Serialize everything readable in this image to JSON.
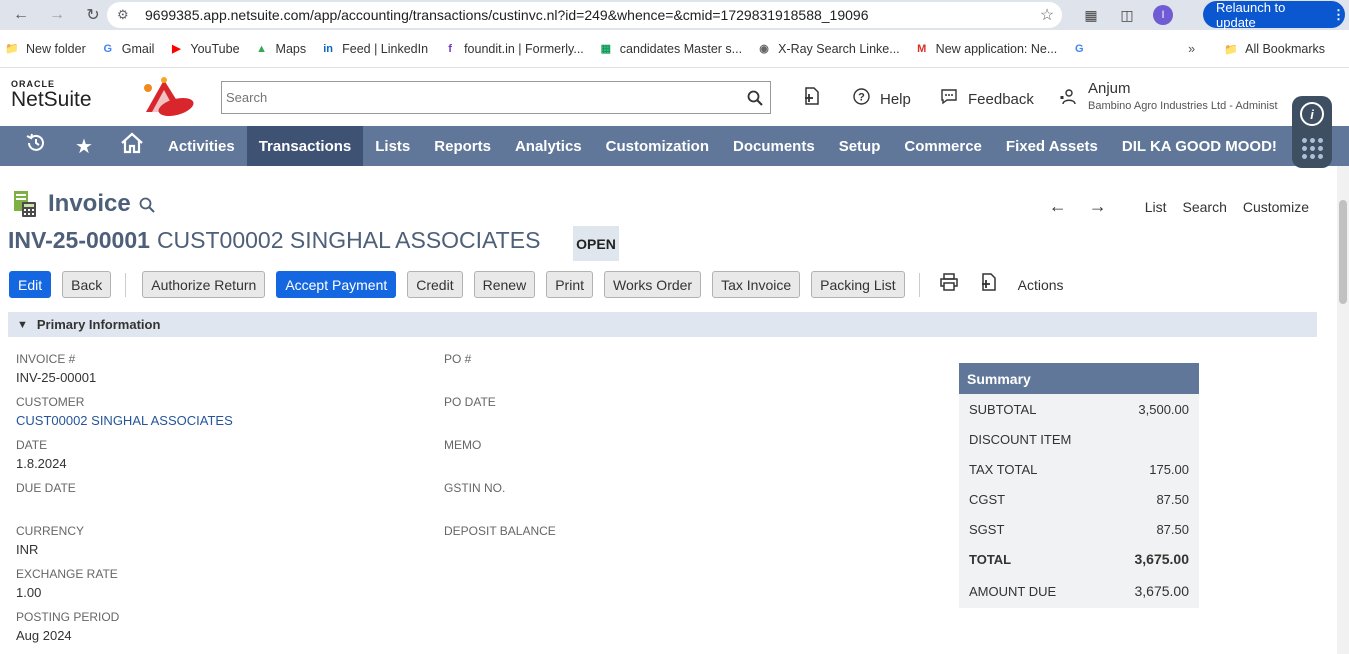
{
  "browser": {
    "url": "9699385.app.netsuite.com/app/accounting/transactions/custinvc.nl?id=249&whence=&cmid=1729831918588_19096",
    "relaunch_label": "Relaunch to update",
    "avatar_letter": "I",
    "bookmarks": [
      {
        "label": "New folder",
        "icon": "folder-icon",
        "color": "#444"
      },
      {
        "label": "Gmail",
        "icon": "google-icon",
        "color": "#4285f4"
      },
      {
        "label": "YouTube",
        "icon": "youtube-icon",
        "color": "#ff0000"
      },
      {
        "label": "Maps",
        "icon": "maps-icon",
        "color": "#34a853"
      },
      {
        "label": "Feed | LinkedIn",
        "icon": "linkedin-icon",
        "color": "#0a66c2"
      },
      {
        "label": "foundit.in | Formerly...",
        "icon": "foundit-icon",
        "color": "#6e3cbc"
      },
      {
        "label": "candidates Master s...",
        "icon": "sheets-icon",
        "color": "#0f9d58"
      },
      {
        "label": "X-Ray Search Linke...",
        "icon": "globe-icon",
        "color": "#666"
      },
      {
        "label": "New application: Ne...",
        "icon": "gmail-icon",
        "color": "#d93025"
      },
      {
        "label": "",
        "icon": "google-icon",
        "color": "#4285f4"
      }
    ],
    "all_bookmarks_label": "All Bookmarks"
  },
  "header": {
    "logo_oracle": "ORACLE",
    "logo_netsuite": "NetSuite",
    "search_placeholder": "Search",
    "help_label": "Help",
    "feedback_label": "Feedback",
    "user_name": "Anjum",
    "user_company": "Bambino Agro Industries Ltd - Administ"
  },
  "nav": {
    "items": [
      "Activities",
      "Transactions",
      "Lists",
      "Reports",
      "Analytics",
      "Customization",
      "Documents",
      "Setup",
      "Commerce",
      "Fixed Assets",
      "DIL KA GOOD MOOD!"
    ],
    "active": "Transactions"
  },
  "page": {
    "title": "Invoice",
    "record_number": "INV-25-00001",
    "record_customer": "CUST00002 SINGHAL ASSOCIATES",
    "status": "OPEN",
    "links": {
      "list": "List",
      "search": "Search",
      "customize": "Customize"
    },
    "buttons": {
      "edit": "Edit",
      "back": "Back",
      "authorize_return": "Authorize Return",
      "accept_payment": "Accept Payment",
      "credit": "Credit",
      "renew": "Renew",
      "print": "Print",
      "works_order": "Works Order",
      "tax_invoice": "Tax Invoice",
      "packing_list": "Packing List",
      "actions": "Actions"
    }
  },
  "primary": {
    "section_title": "Primary Information",
    "left": [
      {
        "label": "INVOICE #",
        "value": "INV-25-00001"
      },
      {
        "label": "CUSTOMER",
        "value": "CUST00002 SINGHAL ASSOCIATES"
      },
      {
        "label": "DATE",
        "value": "1.8.2024"
      },
      {
        "label": "DUE DATE",
        "value": ""
      },
      {
        "label": "CURRENCY",
        "value": "INR"
      },
      {
        "label": "EXCHANGE RATE",
        "value": "1.00"
      },
      {
        "label": "POSTING PERIOD",
        "value": "Aug 2024"
      }
    ],
    "middle": [
      {
        "label": "PO #",
        "value": ""
      },
      {
        "label": "PO DATE",
        "value": ""
      },
      {
        "label": "MEMO",
        "value": ""
      },
      {
        "label": "GSTIN NO.",
        "value": ""
      },
      {
        "label": "DEPOSIT BALANCE",
        "value": ""
      }
    ]
  },
  "summary": {
    "title": "Summary",
    "rows": [
      {
        "label": "SUBTOTAL",
        "amount": "3,500.00"
      },
      {
        "label": "DISCOUNT ITEM",
        "amount": ""
      },
      {
        "label": "TAX TOTAL",
        "amount": "175.00"
      },
      {
        "label": "CGST",
        "amount": "87.50"
      },
      {
        "label": "SGST",
        "amount": "87.50"
      },
      {
        "label": "TOTAL",
        "amount": "3,675.00"
      },
      {
        "label": "AMOUNT DUE",
        "amount": "3,675.00"
      }
    ]
  },
  "colors": {
    "nav_bg": "#607799",
    "nav_active": "#3e5374",
    "primary_button": "#1467e0",
    "title_color": "#4d5f79",
    "link_color": "#255599"
  }
}
